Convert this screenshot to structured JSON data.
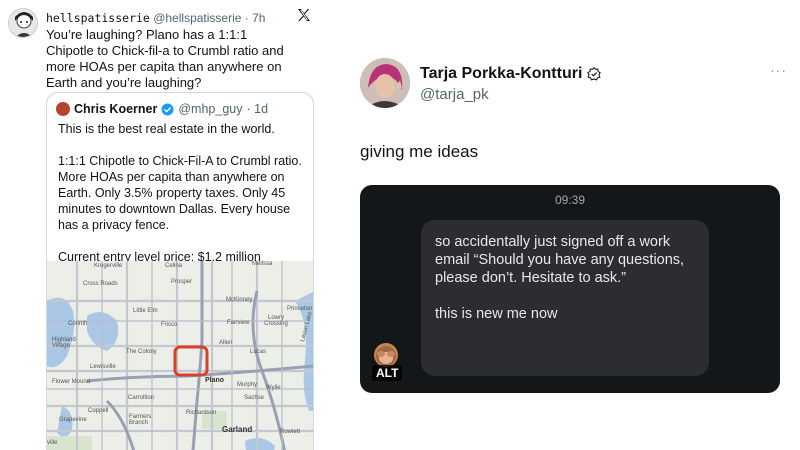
{
  "left_post": {
    "display_name": "hellspatisserie",
    "handle": "@hellspatisserie",
    "time": "· 7h",
    "text": "You’re laughing? Plano has a 1:1:1 Chipotle to Chick-fil-a to Crumbl ratio and more HOAs per capita than anywhere on Earth and you’re laughing?",
    "quote": {
      "name": "Chris Koerner",
      "handle": "@mhp_guy",
      "time": "· 1d",
      "paragraphs": [
        "This is the best real estate in the world.",
        "1:1:1 Chipotle to Chick-Fil-A to Crumbl ratio. More HOAs per capita than anywhere on Earth. Only 3.5% property taxes. Only 45 minutes to downtown Dallas. Every house has a privacy fence.",
        "Current entry level price: $1.2 million"
      ],
      "map_labels": {
        "krugerville": "Krugerville",
        "melissa": "Melissa",
        "cross_roads": "Cross Roads",
        "prosper": "Prosper",
        "celina": "Celina",
        "mckinney": "McKinney",
        "little_elm": "Little Elm",
        "frisco": "Frisco",
        "princeton": "Princeton",
        "fairview": "Fairview",
        "lowry_crossing": "Lowry Crossing",
        "corinth": "Corinth",
        "highland_village": "Highland Village",
        "the_colony": "The Colony",
        "allen": "Allen",
        "lucas": "Lucas",
        "lewisville": "Lewisville",
        "flower_mound": "Flower Mound",
        "plano": "Plano",
        "murphy": "Murphy",
        "wylie": "Wylie",
        "carrollton": "Carrollton",
        "sachse": "Sachse",
        "coppell": "Coppell",
        "richardson": "Richardson",
        "grapevine": "Grapevine",
        "farmers_branch": "Farmers Branch",
        "garland": "Garland",
        "rowlett": "Rowlett",
        "lavon_lake": "Lavon Lake",
        "ville": "ville"
      }
    }
  },
  "right_post": {
    "display_name": "Tarja Porkka-Kontturi",
    "handle": "@tarja_pk",
    "more": "···",
    "text": "giving me ideas",
    "image": {
      "time": "09:39",
      "bubble_paragraphs": [
        "so accidentally just signed off a work email “Should you have any questions, please don’t. Hesitate to ask.”",
        "this is new me now"
      ],
      "alt_badge": "ALT"
    }
  },
  "colors": {
    "text": "#0f1419",
    "muted": "#536471",
    "verified_blue": "#1d9bf0",
    "phone_bg": "#14171a",
    "bubble_bg": "#2b2d30",
    "map_highlight": "#d6412a"
  }
}
